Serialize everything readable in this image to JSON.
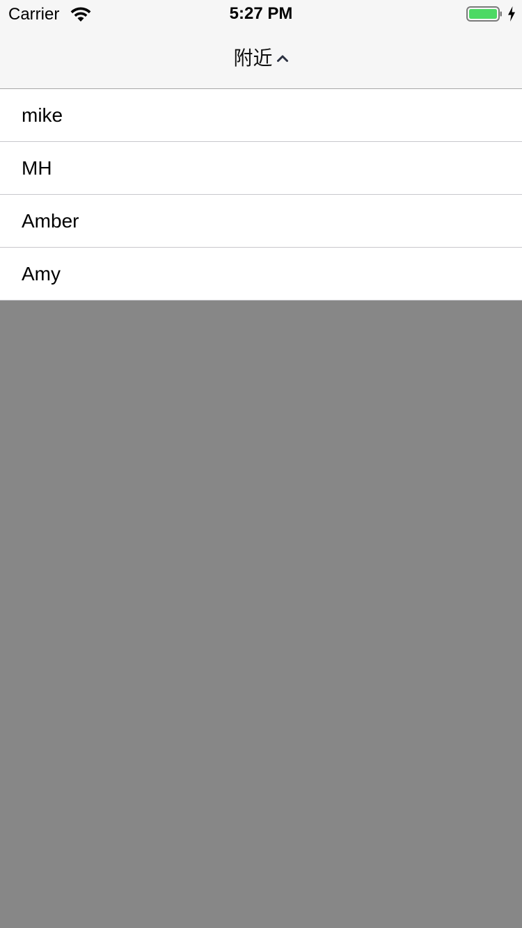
{
  "status_bar": {
    "carrier": "Carrier",
    "time": "5:27 PM",
    "wifi_icon": "wifi-icon",
    "battery_icon": "battery-charging-icon",
    "battery_color": "#4cd964"
  },
  "nav": {
    "title": "附近",
    "toggle_icon": "chevron-up-icon"
  },
  "dropdown": {
    "items": [
      {
        "label": "mike"
      },
      {
        "label": "MH"
      },
      {
        "label": "Amber"
      },
      {
        "label": "Amy"
      }
    ]
  },
  "overlay_color": "#878787"
}
